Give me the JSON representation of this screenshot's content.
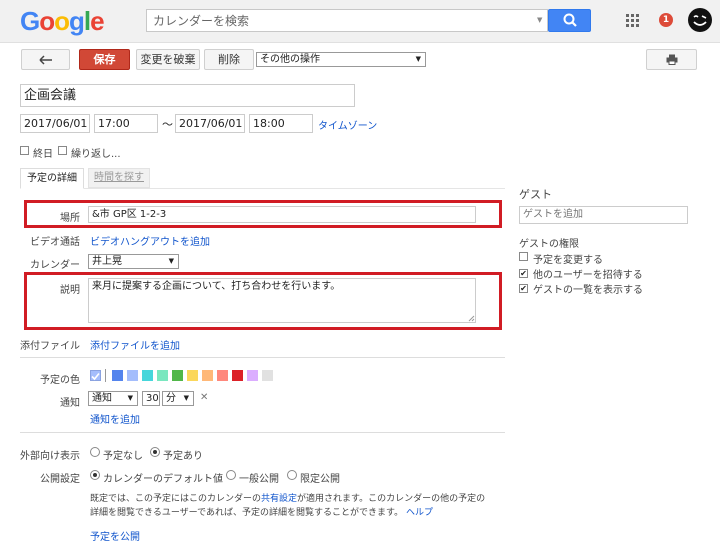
{
  "header": {
    "logo": [
      {
        "ch": "G",
        "color": "#4285f4"
      },
      {
        "ch": "o",
        "color": "#ea4335"
      },
      {
        "ch": "o",
        "color": "#fbbc05"
      },
      {
        "ch": "g",
        "color": "#4285f4"
      },
      {
        "ch": "l",
        "color": "#34a853"
      },
      {
        "ch": "e",
        "color": "#ea4335"
      }
    ],
    "search_placeholder": "カレンダーを検索",
    "notification_count": "1"
  },
  "toolbar": {
    "back_icon": "arrow-left-icon",
    "save_label": "保存",
    "discard_label": "変更を破棄",
    "delete_label": "削除",
    "more_actions": "その他の操作",
    "print_icon": "printer-icon"
  },
  "event": {
    "title": "企画会議",
    "start_date": "2017/06/01",
    "start_time": "17:00",
    "range_sep": "〜",
    "end_date": "2017/06/01",
    "end_time": "18:00",
    "timezone_link": "タイムゾーン",
    "all_day_label": "終日",
    "repeat_label": "繰り返し..."
  },
  "tabs": {
    "details": "予定の詳細",
    "find_time": "時間を探す"
  },
  "details": {
    "location_label": "場所",
    "location_value": "&市 GP区 1-2-3",
    "video_label": "ビデオ通話",
    "video_link": "ビデオハングアウトを追加",
    "calendar_label": "カレンダー",
    "calendar_value": "井上晃",
    "description_label": "説明",
    "description_value": "来月に提案する企画について、打ち合わせを行います。",
    "attachment_label": "添付ファイル",
    "attachment_link": "添付ファイルを追加",
    "color_label": "予定の色",
    "colors": [
      "#a4bdfc",
      "#5484ed",
      "#a4bdfc",
      "#46d6db",
      "#7ae7bf",
      "#51b749",
      "#fbd75b",
      "#ffb878",
      "#ff887c",
      "#dc2127",
      "#dbadff",
      "#e1e1e1"
    ],
    "notify_label": "通知",
    "notify_type": "通知",
    "notify_amount": "30",
    "notify_unit": "分",
    "add_notification": "通知を追加",
    "availability_label": "外部向け表示",
    "availability_options": [
      "予定なし",
      "予定あり"
    ],
    "privacy_label": "公開設定",
    "privacy_options": [
      "カレンダーのデフォルト値",
      "一般公開",
      "限定公開"
    ],
    "privacy_note_1a": "既定では、この予定にはこのカレンダーの",
    "privacy_note_link": "共有設定",
    "privacy_note_1b": "が適用されます。このカレンダーの他の予定の",
    "privacy_note_2": "詳細を閲覧できるユーザーであれば、予定の詳細を閲覧することができます。",
    "help_link": "ヘルプ",
    "publish_link": "予定を公開"
  },
  "guests": {
    "title": "ゲスト",
    "add_placeholder": "ゲストを追加",
    "permissions_title": "ゲストの権限",
    "permissions": [
      {
        "label": "予定を変更する",
        "checked": false
      },
      {
        "label": "他のユーザーを招待する",
        "checked": true
      },
      {
        "label": "ゲストの一覧を表示する",
        "checked": true
      }
    ]
  }
}
